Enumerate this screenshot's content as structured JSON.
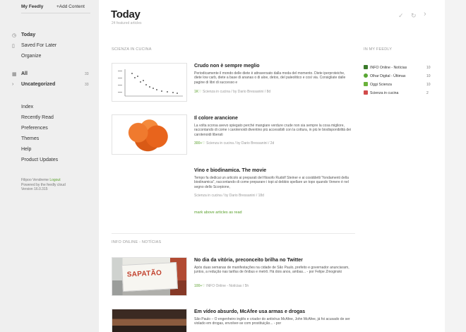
{
  "sidebar": {
    "tabs": {
      "my_feedly": "My Feedly",
      "add_content": "+Add Content"
    },
    "nav": [
      {
        "label": "Today",
        "icon": "today-icon"
      },
      {
        "label": "Saved For Later",
        "icon": "bookmark-icon"
      },
      {
        "label": "Organize"
      }
    ],
    "categories": [
      {
        "label": "All",
        "count": "33"
      },
      {
        "label": "Uncategorized",
        "count": "33"
      }
    ],
    "links": [
      {
        "label": "Index"
      },
      {
        "label": "Recently Read"
      },
      {
        "label": "Preferences"
      },
      {
        "label": "Themes"
      },
      {
        "label": "Help"
      },
      {
        "label": "Product Updates"
      }
    ],
    "footer": {
      "user": "Filipoo Vendreme",
      "logout": "Logout",
      "powered": "Powered by the feedly cloud",
      "version": "Version 16.0.315"
    }
  },
  "main": {
    "title": "Today",
    "subtitle": "24 featured articles",
    "icons": [
      {
        "name": "checkmark-icon",
        "glyph": "✓"
      },
      {
        "name": "refresh-icon",
        "glyph": "↻"
      },
      {
        "name": "chevron-right-icon",
        "glyph": "›"
      }
    ],
    "section1": {
      "label": "SCIENZA IN CUCINA",
      "articles": [
        {
          "title": "Crudo non è sempre meglio",
          "body": "Periodicamente il mondo delle diete è attraversato dalla moda del momento. Diete iperproteiche, diete low carb, diete a base di ananas o di aloe, detox, del paleolitico e così via. Consigliate dalle pagine di libri di successo e",
          "likes": "1K♡",
          "meta": "Scienza in cucina / by Dario Bressanini / 8d",
          "thumb": "chart"
        },
        {
          "title": "Il colore arancione",
          "body": "La volta scorsa avevo spiegato perché mangiare verdure crude non sia sempre la cosa migliore, raccontando di come i carotenoidi diventino più accessibili con la cottura, in più le biodisponibilità dei carotenoidi liberati",
          "likes": "300+♡",
          "meta": "Scienza in cucina / by Dario Bressanini / 2d",
          "thumb": "carrot"
        },
        {
          "title": "Vino e biodinamica. The movie",
          "body": "Tempo fa dedicai un articolo ai preparati del filosofo Rudolf Steiner e ai cosiddetti \"fondamenti della biodinamica\", raccontando di come preparare i topi al debbio spellare un topo quando Venere è nel segno dello Scorpione,",
          "likes": "",
          "meta": "Scienza in cucina / by Dario Bressanini / 18d",
          "thumb": ""
        }
      ],
      "mark_read": "mark above articles as read"
    },
    "section2": {
      "label": "INFO ONLINE - NOTÍCIAS",
      "articles": [
        {
          "title": "No dia da vitória, preconceito brilha no Twitter",
          "body": "Após duas semanas de manifestações na cidade de São Paulo, prefeito e governador anunciaram, juntos, a redução nas tarifas de ônibus e metrô. Há dois anos, ambas... - por Felipe Zmoginski",
          "likes": "100+♡",
          "meta": "INFO Online - Notícias / 5h",
          "thumb": "protest",
          "sign_text": "SAPATÃO"
        },
        {
          "title": "Em vídeo absurdo, McAfee usa armas e drogas",
          "body": "São Paulo – O engenheiro inglês e criador do antivírus McAfee, John McAfee, já foi acusado de ser violado em drogas, envolver-se com prostituição... - por",
          "likes": "",
          "meta": "",
          "thumb": "crowd"
        }
      ]
    }
  },
  "in_my_feedly": {
    "label": "IN MY FEEDLY",
    "items": [
      {
        "label": "INFO Online - Notícias",
        "count": "10",
        "color": "#3a7a2a"
      },
      {
        "label": "Olhar Digital - Últimas",
        "count": "10",
        "color": "#58a633"
      },
      {
        "label": "Oggi Scienza",
        "count": "10",
        "color": "#6ab23b"
      },
      {
        "label": "Scienza in cucina",
        "count": "2",
        "color": "#d14b4b"
      }
    ]
  }
}
